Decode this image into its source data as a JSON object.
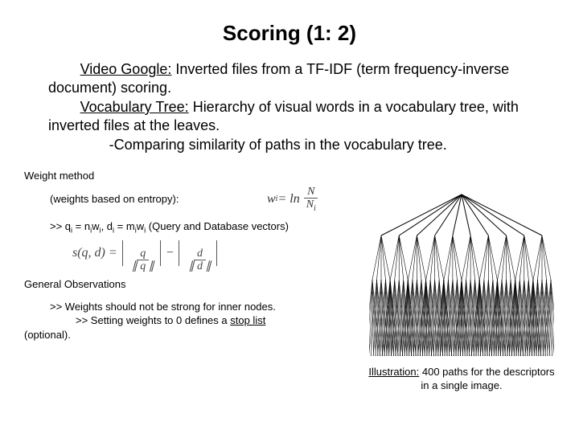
{
  "title": "Scoring (1: 2)",
  "body": {
    "p1_label": "Video Google:",
    "p1_rest": " Inverted files from a TF-IDF (term frequency-inverse document) scoring.",
    "p2_label": "Vocabulary Tree:",
    "p2_rest": " Hierarchy of visual words in a vocabulary tree, with inverted files at the leaves.",
    "p3": "-Comparing similarity of paths in the vocabulary tree."
  },
  "weight": {
    "hdr": "Weight method",
    "sub": "(weights based on entropy):",
    "wi_lhs": "w",
    "wi_eq": " = ln",
    "wi_num": "N",
    "wi_den": "N",
    "vectors": ">> q",
    "vectors_mid1": " = n",
    "vectors_mid2": "w",
    "vectors_mid3": ", d",
    "vectors_mid4": " = m",
    "vectors_mid5": "w",
    "vectors_tail": "  (Query and Database vectors)"
  },
  "sqd": {
    "lhs": "s(q, d) = ",
    "q": "q",
    "qn": "∥ q ∥",
    "minus": "−",
    "d": "d",
    "dn": "∥ d ∥"
  },
  "obs": {
    "hdr": "General Observations",
    "l1": ">> Weights should not be strong for inner nodes.",
    "l2a": ">> Setting weights to 0 defines a ",
    "l2b": "stop list",
    "l3": "(optional)."
  },
  "illus": {
    "cap_label": "Illustration:",
    "cap_rest": " 400 paths for the descriptors in a single image."
  }
}
